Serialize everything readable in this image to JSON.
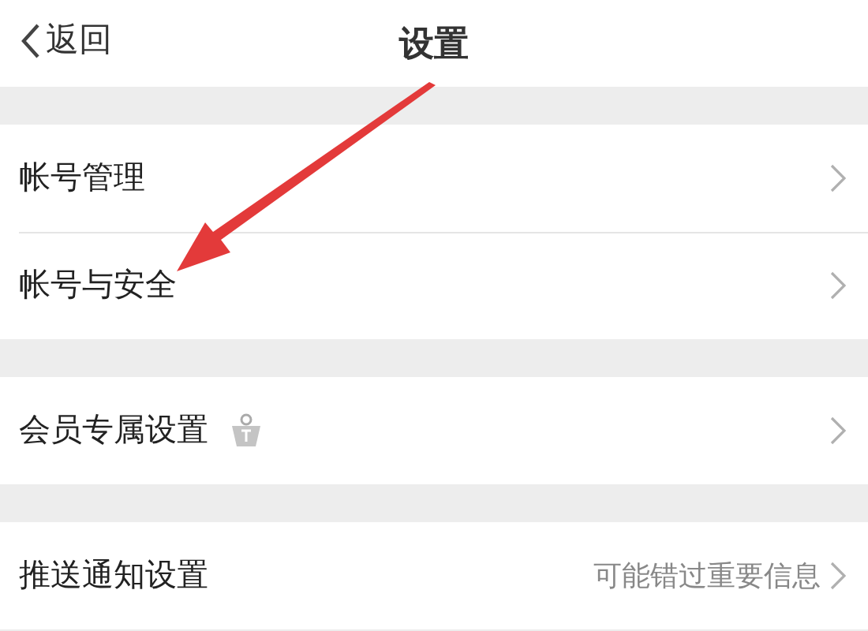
{
  "nav": {
    "back": "返回",
    "title": "设置"
  },
  "groups": [
    {
      "rows": [
        {
          "label": "帐号管理"
        },
        {
          "label": "帐号与安全"
        }
      ]
    },
    {
      "rows": [
        {
          "label": "会员专属设置",
          "kind": "crown"
        }
      ]
    },
    {
      "rows": [
        {
          "label": "推送通知设置",
          "hint": "可能错过重要信息"
        }
      ]
    }
  ]
}
